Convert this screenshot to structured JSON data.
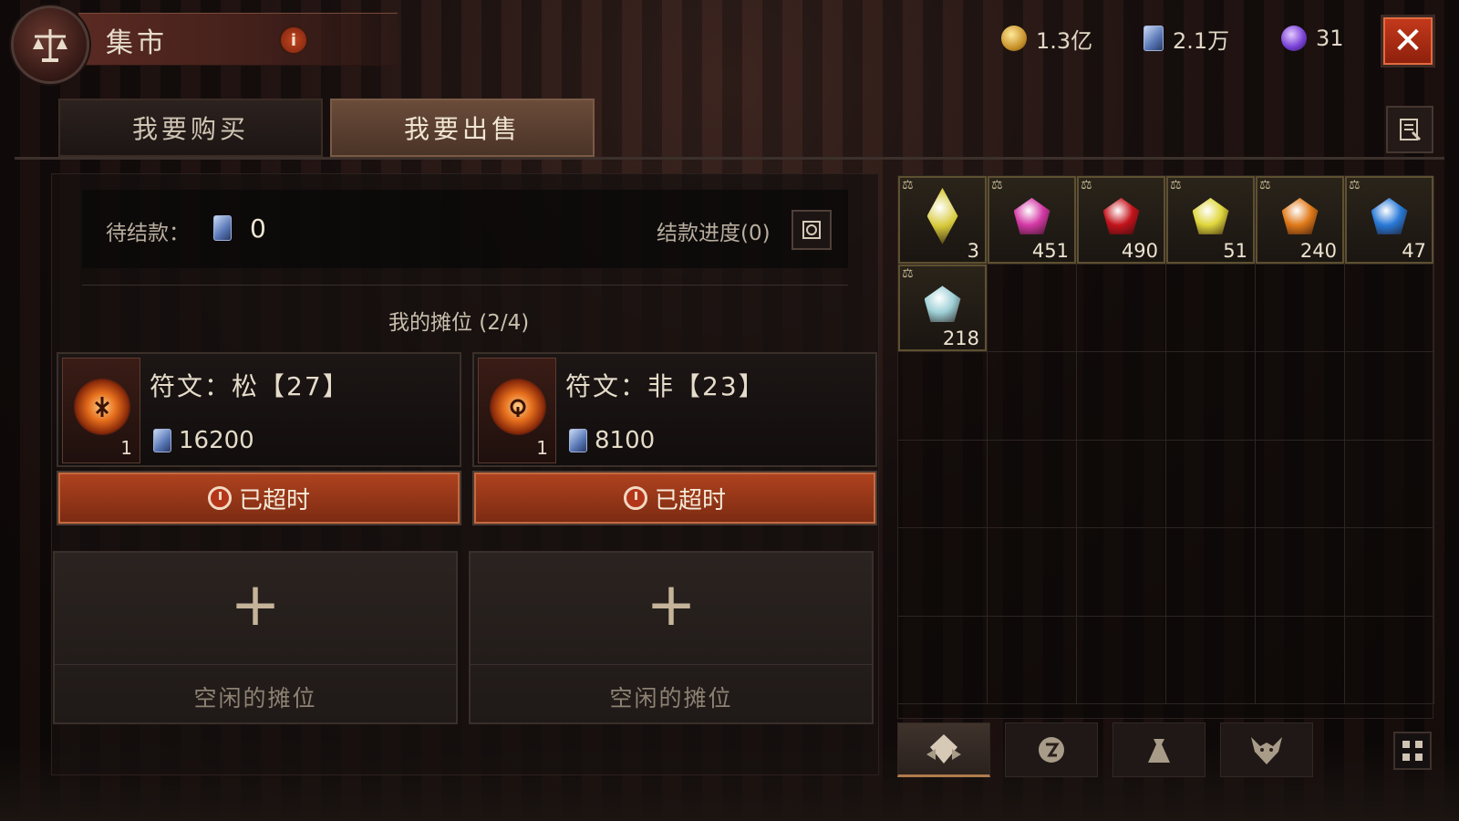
{
  "header": {
    "title": "集市",
    "info_label": "i",
    "close_label": "✕"
  },
  "currencies": [
    {
      "icon": "gold-coin-icon",
      "value": "1.3亿"
    },
    {
      "icon": "rune-tablet-icon",
      "value": "2.1万"
    },
    {
      "icon": "purple-orb-icon",
      "value": "31"
    }
  ],
  "tabs": [
    {
      "label": "我要购买",
      "active": false
    },
    {
      "label": "我要出售",
      "active": true
    }
  ],
  "pending": {
    "label": "待结款：",
    "value": "0",
    "progress_label": "结款进度(0)"
  },
  "stalls": {
    "title": "我的摊位 (2/4)",
    "occupied": [
      {
        "name": "符文：松【27】",
        "count": "1",
        "price": "16200",
        "status": "已超时"
      },
      {
        "name": "符文：非【23】",
        "count": "1",
        "price": "8100",
        "status": "已超时"
      }
    ],
    "empty": [
      {
        "plus": "+",
        "label": "空闲的摊位"
      },
      {
        "plus": "+",
        "label": "空闲的摊位"
      }
    ]
  },
  "inventory": {
    "items": [
      {
        "gem": "yellow-crystal",
        "count": "3",
        "color": "#d6c93a"
      },
      {
        "gem": "amethyst",
        "count": "451",
        "color": "#d43aa6"
      },
      {
        "gem": "ruby",
        "count": "490",
        "color": "#c4141c"
      },
      {
        "gem": "topaz",
        "count": "51",
        "color": "#e0d63c"
      },
      {
        "gem": "amber",
        "count": "240",
        "color": "#e07a1a"
      },
      {
        "gem": "sapphire",
        "count": "47",
        "color": "#2a7ad8"
      },
      {
        "gem": "diamond",
        "count": "218",
        "color": "#9ed0d6"
      }
    ],
    "tag_glyph": "⚖",
    "tabs": [
      "gem-category-icon",
      "rune-category-icon",
      "bag-category-icon",
      "demon-category-icon"
    ]
  }
}
